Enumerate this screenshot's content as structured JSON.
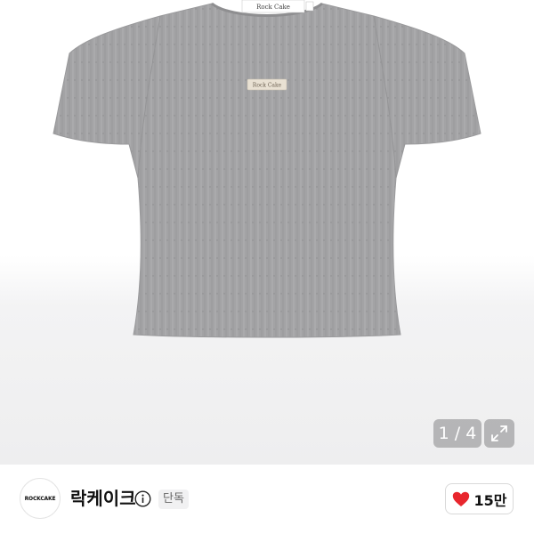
{
  "gallery": {
    "image_alt": "grey ribbed short-sleeve t-shirt",
    "garment_color": "#a3a3a5",
    "neck_label_text": "Rock Cake",
    "chest_label_text": "Rock Cake",
    "counter_text": "1 / 4",
    "expand_icon": "expand-icon"
  },
  "seller": {
    "avatar_text": "ROCKCAKE",
    "name": "락케이크",
    "info_icon": "info-icon",
    "badge": "단독"
  },
  "like": {
    "icon": "heart-icon",
    "icon_color": "#e8262d",
    "count": "15만"
  }
}
